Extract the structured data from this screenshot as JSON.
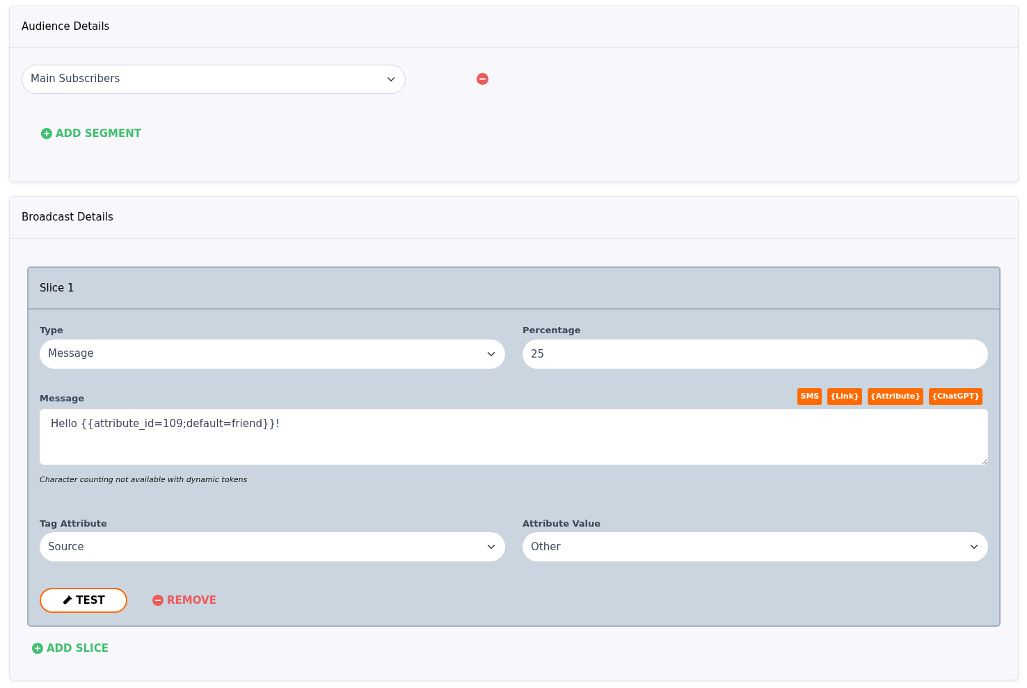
{
  "audience": {
    "title": "Audience Details",
    "segments": [
      {
        "value": "Main Subscribers"
      }
    ],
    "add_label": "ADD SEGMENT"
  },
  "broadcast": {
    "title": "Broadcast Details",
    "slices": [
      {
        "title": "Slice 1",
        "type_label": "Type",
        "type_value": "Message",
        "percentage_label": "Percentage",
        "percentage_value": "25",
        "message_label": "Message",
        "tokens": [
          "SMS",
          "{Link}",
          "{Attribute}",
          "{ChatGPT}"
        ],
        "message_value": "Hello {{attribute_id=109;default=friend}}!",
        "hint": "Character counting not available with dynamic tokens",
        "tag_label": "Tag Attribute",
        "tag_value": "Source",
        "attr_label": "Attribute Value",
        "attr_value": "Other",
        "test_label": "TEST",
        "remove_label": "REMOVE"
      }
    ],
    "add_label": "ADD SLICE"
  }
}
